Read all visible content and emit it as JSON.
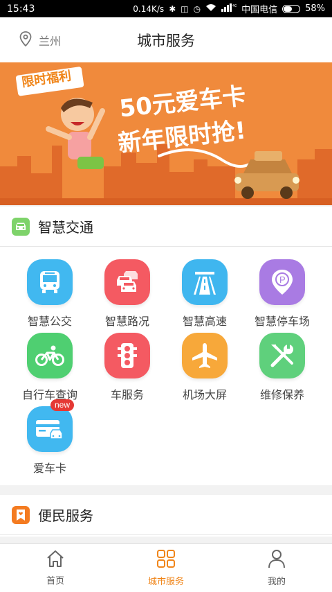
{
  "status_bar": {
    "time": "15:43",
    "speed": "0.14K/s",
    "carrier": "中国电信",
    "battery_percent": "58%",
    "battery_level": 0.58
  },
  "header": {
    "location": "兰州",
    "title": "城市服务"
  },
  "banner": {
    "tag": "限时福利",
    "line1": "50元爱车卡",
    "line2": "新年限时抢!"
  },
  "sections": [
    {
      "title": "智慧交通",
      "color": "#7ed36a",
      "items": [
        {
          "label": "智慧公交",
          "icon": "bus-icon",
          "color": "#41b8f0"
        },
        {
          "label": "智慧路况",
          "icon": "traffic-cars-icon",
          "color": "#f45a62"
        },
        {
          "label": "智慧高速",
          "icon": "highway-icon",
          "color": "#3fb6ef"
        },
        {
          "label": "智慧停车场",
          "icon": "parking-pin-icon",
          "color": "#a97be3"
        },
        {
          "label": "自行车查询",
          "icon": "bicycle-icon",
          "color": "#4fcf71"
        },
        {
          "label": "车服务",
          "icon": "traffic-light-icon",
          "color": "#f45a62"
        },
        {
          "label": "机场大屏",
          "icon": "airplane-icon",
          "color": "#f7a83a"
        },
        {
          "label": "维修保养",
          "icon": "wrench-screwdriver-icon",
          "color": "#5fd07c"
        },
        {
          "label": "爱车卡",
          "icon": "car-card-icon",
          "color": "#41b8f0",
          "badge": "new"
        }
      ]
    },
    {
      "title": "便民服务",
      "color": "#f47b20"
    }
  ],
  "tabbar": {
    "active_color": "#f08519",
    "tabs": [
      {
        "label": "首页",
        "icon": "home-icon"
      },
      {
        "label": "城市服务",
        "icon": "grid-icon",
        "active": true
      },
      {
        "label": "我的",
        "icon": "person-icon"
      }
    ]
  }
}
